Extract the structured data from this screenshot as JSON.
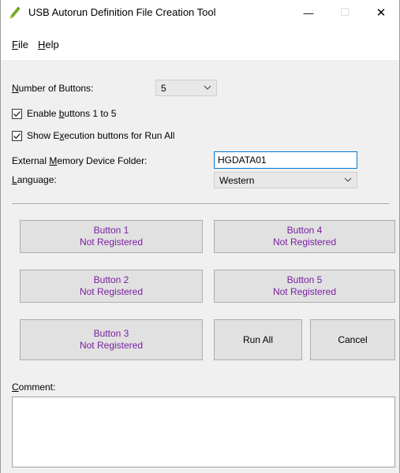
{
  "window": {
    "title": "USB Autorun Definition File Creation Tool",
    "minimize_glyph": "—",
    "maximize_glyph": "□",
    "close_glyph": "✕"
  },
  "menu": {
    "file": {
      "accel": "F",
      "rest": "ile"
    },
    "help": {
      "accel": "H",
      "rest": "elp"
    }
  },
  "settings": {
    "number_of_buttons_label": {
      "accel": "N",
      "rest": "umber of Buttons:"
    },
    "number_of_buttons_value": "5",
    "enable_buttons": {
      "before": "Enable ",
      "accel": "b",
      "after": "uttons 1 to 5",
      "checked": true
    },
    "show_execution": {
      "before": "Show E",
      "accel": "x",
      "after": "ecution buttons for Run All",
      "checked": true
    },
    "folder_label": {
      "before": "External ",
      "accel": "M",
      "after": "emory Device Folder:"
    },
    "folder_value": "HGDATA01",
    "language_label": {
      "accel": "L",
      "rest": "anguage:"
    },
    "language_value": "Western"
  },
  "buttons": [
    {
      "name": "Button 1",
      "status": "Not Registered"
    },
    {
      "name": "Button 2",
      "status": "Not Registered"
    },
    {
      "name": "Button 3",
      "status": "Not Registered"
    },
    {
      "name": "Button 4",
      "status": "Not Registered"
    },
    {
      "name": "Button 5",
      "status": "Not Registered"
    }
  ],
  "actions": {
    "run_all": "Run All",
    "cancel": "Cancel"
  },
  "comment": {
    "label": {
      "accel": "C",
      "rest": "omment:"
    },
    "value": ""
  },
  "colors": {
    "registered_text": "#7a1fa2",
    "focus_border": "#0078d7",
    "icon_green": "#7cb518",
    "icon_yellow": "#f2c200"
  }
}
